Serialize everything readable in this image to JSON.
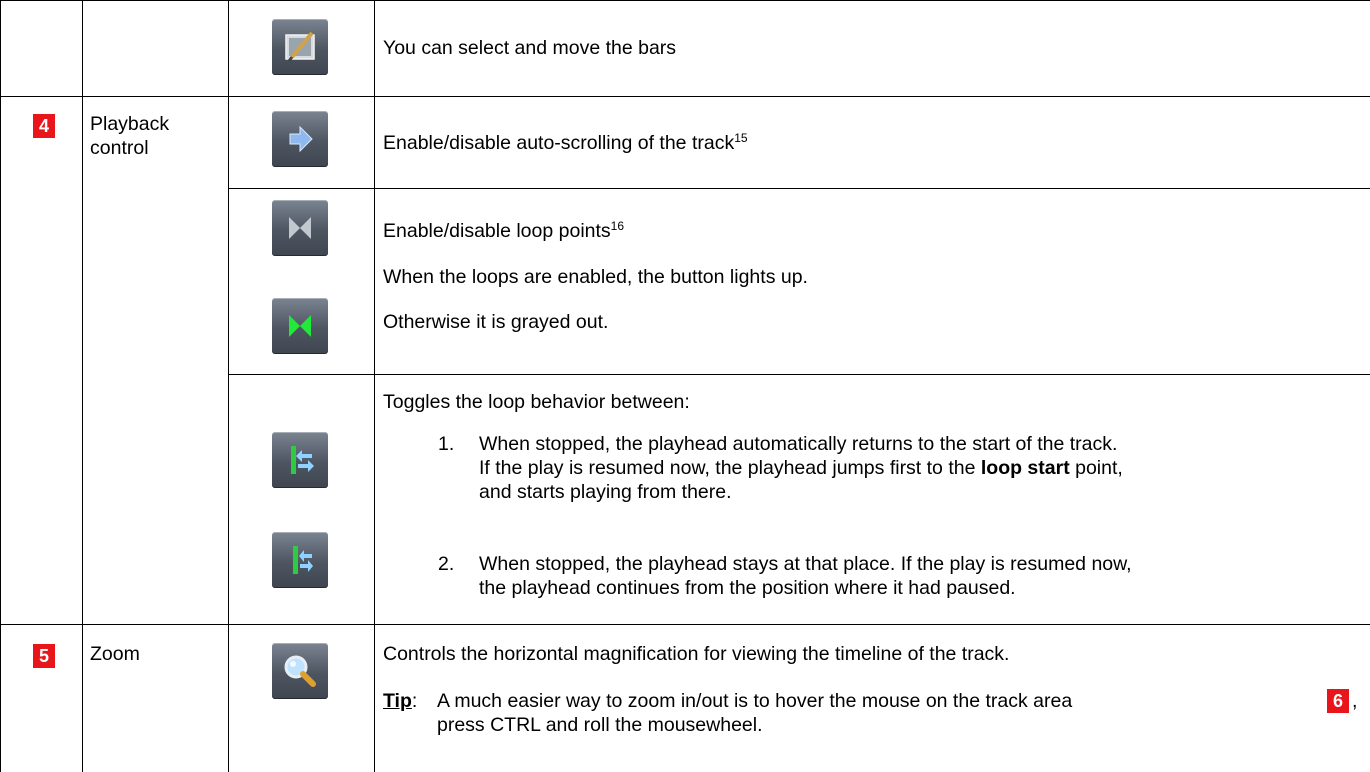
{
  "rows": {
    "edit": {
      "description": "You can select and move the bars"
    },
    "playback": {
      "number": "4",
      "label_line1": "Playback",
      "label_line2": "control",
      "autoscroll": {
        "text": "Enable/disable auto-scrolling of the track",
        "footnote": "15"
      },
      "loop_points": {
        "text": "Enable/disable loop points",
        "footnote": "16",
        "line2": "When the loops are enabled, the button lights up.",
        "line3": "Otherwise it is grayed out."
      },
      "loop_behavior": {
        "intro": "Toggles the loop behavior between:",
        "item1_num": "1.",
        "item1_line1": "When stopped, the playhead automatically returns to the start of the track.",
        "item1_line2_pre": "If the play is resumed now, the playhead jumps first to the ",
        "item1_line2_bold": "loop start",
        "item1_line2_post": " point,",
        "item1_line3": "and starts playing from there.",
        "item2_num": "2.",
        "item2_line1": "When stopped, the playhead stays at that place. If the play is resumed now,",
        "item2_line2": "the playhead continues from the position where it had paused."
      }
    },
    "zoom": {
      "number": "5",
      "label": "Zoom",
      "description": "Controls the horizontal magnification for viewing the timeline of the track.",
      "tip_label": "Tip",
      "tip_colon": ":",
      "tip_line1": "A much easier way to zoom in/out is to hover the mouse on the track area",
      "tip_badge": "6",
      "tip_comma": ",",
      "tip_line2": "press CTRL and roll the mousewheel."
    }
  },
  "icons": [
    "edit-bars-icon",
    "arrow-right-icon",
    "loop-points-off-icon",
    "loop-points-on-icon",
    "loop-return-start-icon",
    "loop-stay-icon",
    "zoom-magnifier-icon"
  ],
  "colors": {
    "badge": "#e8151b",
    "loop_on": "#22e83a",
    "icon_bg": "#4d5561"
  }
}
